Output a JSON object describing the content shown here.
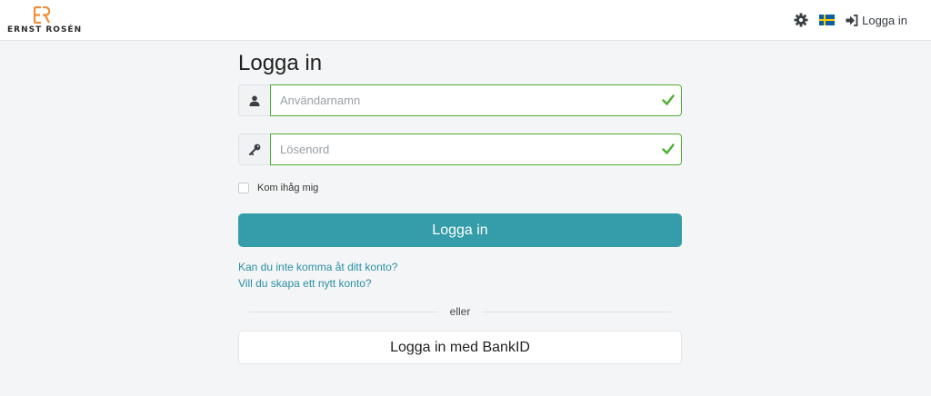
{
  "brand": {
    "name": "ERNST ROSÉN",
    "accent": "#f28c38"
  },
  "header": {
    "settings_icon": "gear-icon",
    "language_flag": "swedish-flag-icon",
    "login_label": "Logga in"
  },
  "login": {
    "title": "Logga in",
    "username_placeholder": "Användarnamn",
    "password_placeholder": "Lösenord",
    "remember_label": "Kom ihåg mig",
    "submit_label": "Logga in",
    "forgot_link": "Kan du inte komma åt ditt konto?",
    "register_link": "Vill du skapa ett nytt konto?",
    "divider_text": "eller",
    "bankid_label": "Logga in med BankID"
  },
  "colors": {
    "primary": "#349da9",
    "valid": "#4caf2f",
    "link": "#2a8fa5"
  }
}
